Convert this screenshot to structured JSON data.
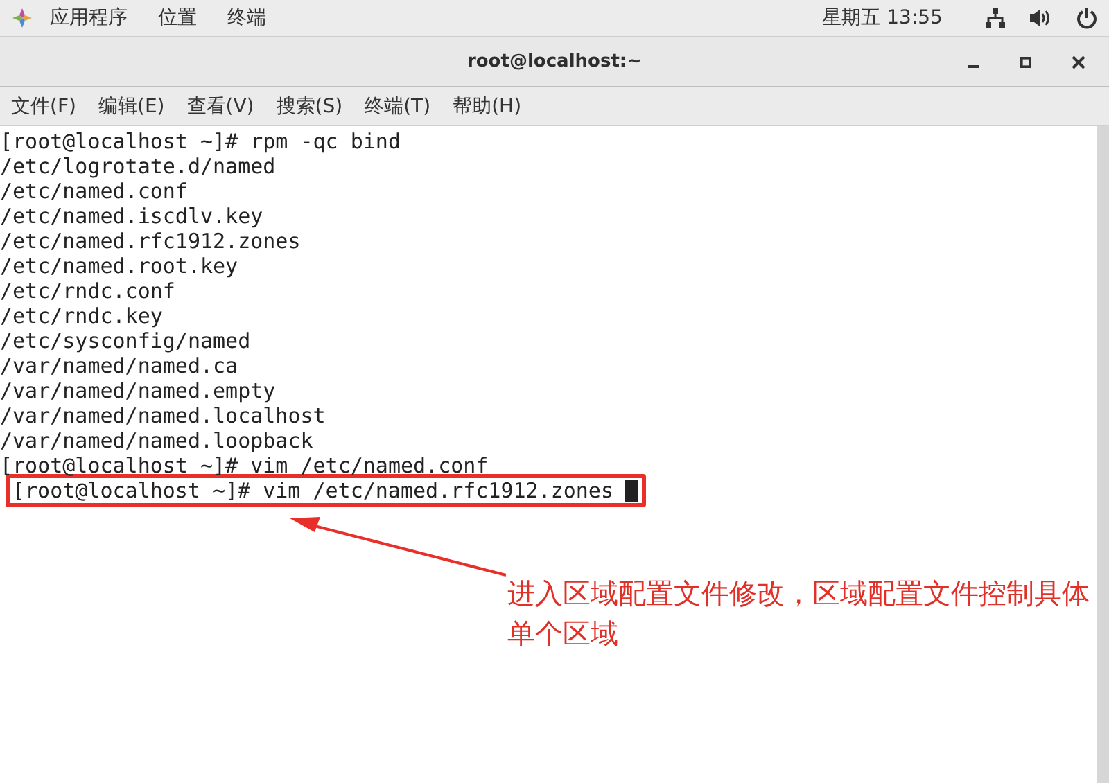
{
  "top_bar": {
    "menus": [
      "应用程序",
      "位置",
      "终端"
    ],
    "clock": "星期五 13:55"
  },
  "window": {
    "title": "root@localhost:~"
  },
  "menu_bar": [
    "文件(F)",
    "编辑(E)",
    "查看(V)",
    "搜索(S)",
    "终端(T)",
    "帮助(H)"
  ],
  "terminal": {
    "lines": [
      {
        "text": "[root@localhost ~]# rpm -qc bind"
      },
      {
        "text": "/etc/logrotate.d/named"
      },
      {
        "text": "/etc/named.conf"
      },
      {
        "text": "/etc/named.iscdlv.key"
      },
      {
        "text": "/etc/named.rfc1912.zones"
      },
      {
        "text": "/etc/named.root.key"
      },
      {
        "text": "/etc/rndc.conf"
      },
      {
        "text": "/etc/rndc.key"
      },
      {
        "text": "/etc/sysconfig/named"
      },
      {
        "text": "/var/named/named.ca"
      },
      {
        "text": "/var/named/named.empty"
      },
      {
        "text": "/var/named/named.localhost"
      },
      {
        "text": "/var/named/named.loopback"
      },
      {
        "text": "[root@localhost ~]# vim /etc/named.conf"
      },
      {
        "text": "[root@localhost ~]# vim /etc/named.rfc1912.zones",
        "highlighted": true,
        "cursor": true
      }
    ]
  },
  "annotation": {
    "text": "进入区域配置文件修改，区域配置文件控制具体单个区域"
  }
}
